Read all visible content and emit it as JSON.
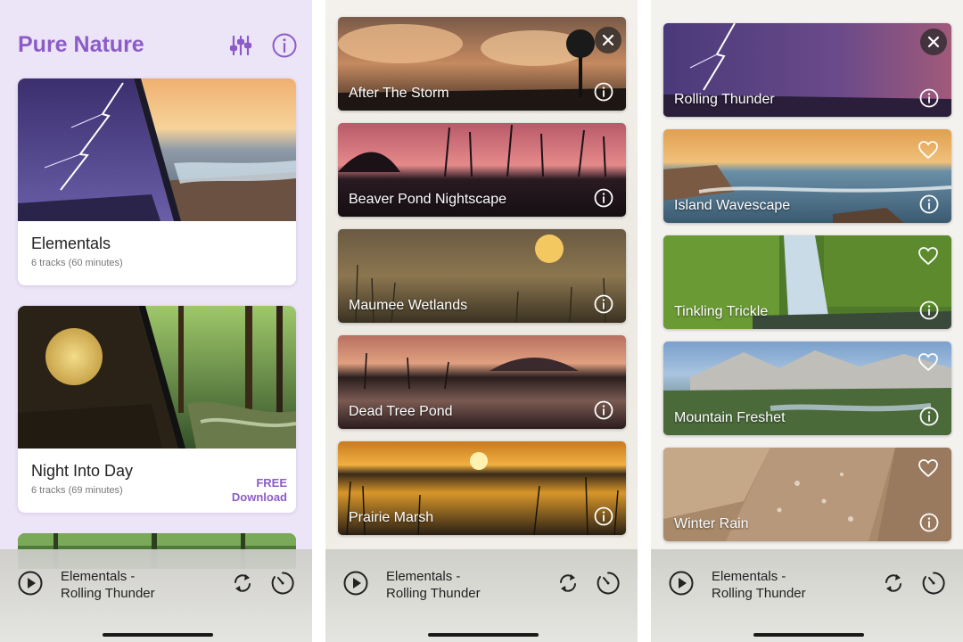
{
  "screen1": {
    "app_title": "Pure Nature",
    "icons": {
      "mixer": "sliders-icon",
      "info": "info-icon"
    },
    "collections": [
      {
        "title": "Elementals",
        "subtitle": "6 tracks (60 minutes)"
      },
      {
        "title": "Night Into Day",
        "subtitle": "6 tracks (69 minutes)",
        "badge_line1": "FREE",
        "badge_line2": "Download"
      }
    ]
  },
  "screen2": {
    "tracks": [
      {
        "label": "After The Storm"
      },
      {
        "label": "Beaver Pond Nightscape"
      },
      {
        "label": "Maumee Wetlands"
      },
      {
        "label": "Dead Tree Pond"
      },
      {
        "label": "Prairie Marsh"
      }
    ]
  },
  "screen3": {
    "tracks": [
      {
        "label": "Rolling Thunder"
      },
      {
        "label": "Island Wavescape"
      },
      {
        "label": "Tinkling Trickle"
      },
      {
        "label": "Mountain Freshet"
      },
      {
        "label": "Winter Rain"
      }
    ]
  },
  "player": {
    "now_playing_line1": "Elementals -",
    "now_playing_line2": "Rolling Thunder"
  },
  "colors": {
    "accent": "#8b5cc8",
    "screen1_bg": "#ece4f7"
  }
}
